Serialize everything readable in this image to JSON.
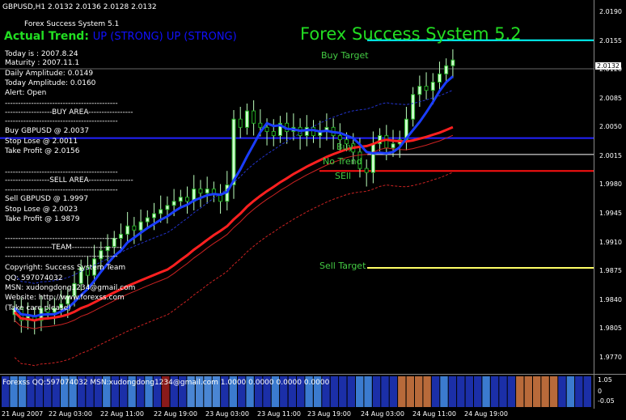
{
  "window": {
    "title": "GBPUSD,H1  2.0132 2.0136 2.0128 2.0132"
  },
  "chart_overlay": {
    "system_name_small": "Forex Success System 5.1",
    "actual_trend_label": "Actual Trend:",
    "actual_trend_value": "UP (STRONG) UP (STRONG)",
    "big_title": "Forex Success System 5.2",
    "today": "Today is   :  2007.8.24",
    "maturity": "Maturity  :  2007.11.1",
    "daily_amplitude": "Daily Amplitude:   0.0149",
    "today_amplitude": "Today Amplitude:   0.0160",
    "alert": "Alert:          Open",
    "divider": "-------------------------------------------",
    "buy_area_header": "------------------BUY AREA-----------------",
    "buy_line": "Buy  GBPUSD  @ 2.0037",
    "buy_stop": "Stop Lose       @ 2.0011",
    "buy_tp": "Take Profit     @ 2.0156",
    "sell_area_header": "-----------------SELL AREA-----------------",
    "sell_line": "Sell  GBPUSD  @ 1.9997",
    "sell_stop": "Stop Lose       @ 2.0023",
    "sell_tp": "Take Profit     @ 1.9879",
    "team_header": "------------------TEAM-------------------",
    "copyright": "Copyright: Success System Team",
    "qq": "QQ:     597074032",
    "msn": "MSN: xudongdong1234@gmail.com",
    "website": "Website: http://www.forexss.com",
    "take_care": "(Take care please)"
  },
  "levels": {
    "buy_target": "Buy Target",
    "buy": "Buy",
    "no_trend": "No Trend",
    "sell": "SEll",
    "sell_target": "Sell Target"
  },
  "price_axis": {
    "ticks": [
      "2.0190",
      "2.0155",
      "2.0120",
      "2.0085",
      "2.0050",
      "2.0015",
      "1.9980",
      "1.9945",
      "1.9910",
      "1.9875",
      "1.9840",
      "1.9805",
      "1.9770"
    ],
    "current": "2.0132"
  },
  "indicator": {
    "label": "Forexss  QQ:597074032  MSN:xudongdong1234@gmail.com  1.0000 0.0000 0.0000 0.0000",
    "axis_ticks": [
      "1.05",
      "0",
      "-0.05"
    ]
  },
  "time_axis": {
    "ticks": [
      "21 Aug 2007",
      "22 Aug 03:00",
      "22 Aug 11:00",
      "22 Aug 19:00",
      "23 Aug 03:00",
      "23 Aug 11:00",
      "23 Aug 19:00",
      "24 Aug 03:00",
      "24 Aug 11:00",
      "24 Aug 19:00"
    ]
  },
  "colors": {
    "background": "#000000",
    "trend_green": "#22dd22",
    "trend_blue": "#1111ff",
    "buy_target_line": "#00ffff",
    "sell_target_line": "#ffff66",
    "buy_line": "#2222ff",
    "sell_line": "#ff1111",
    "level_text": "#44cc44",
    "ma_blue": "#1a3dff",
    "ma_red": "#ff2020",
    "candle_up": "#ccffcc",
    "candle_down": "#22aa22"
  },
  "chart_data": {
    "type": "candlestick",
    "symbol": "GBPUSD",
    "timeframe": "H1",
    "ylim": [
      1.975,
      2.0205
    ],
    "horizontal_levels": [
      {
        "name": "Buy Target",
        "value": 2.0156
      },
      {
        "name": "Buy",
        "value": 2.0037
      },
      {
        "name": "No Trend",
        "value": 2.0017
      },
      {
        "name": "Sell",
        "value": 1.9997
      },
      {
        "name": "Sell Target",
        "value": 1.9879
      }
    ],
    "close_series_approx": [
      1.983,
      1.9815,
      1.982,
      1.9815,
      1.983,
      1.9825,
      1.983,
      1.9835,
      1.9845,
      1.986,
      1.988,
      1.987,
      1.989,
      1.99,
      1.9905,
      1.9915,
      1.992,
      1.993,
      1.9925,
      1.9935,
      1.994,
      1.9945,
      1.995,
      1.9955,
      1.996,
      1.9965,
      1.996,
      1.9975,
      1.997,
      1.9975,
      1.9968,
      1.996,
      1.998,
      2.006,
      2.005,
      2.007,
      2.0055,
      2.005,
      2.0045,
      2.004,
      2.0055,
      2.0045,
      2.005,
      2.004,
      2.005,
      2.004,
      2.0045,
      2.005,
      2.004,
      2.0035,
      2.003,
      2.002,
      2.0,
      1.9995,
      2.003,
      2.004,
      2.0025,
      2.003,
      2.0035,
      2.006,
      2.009,
      2.01,
      2.0095,
      2.0105,
      2.0115,
      2.0125,
      2.0132
    ]
  }
}
